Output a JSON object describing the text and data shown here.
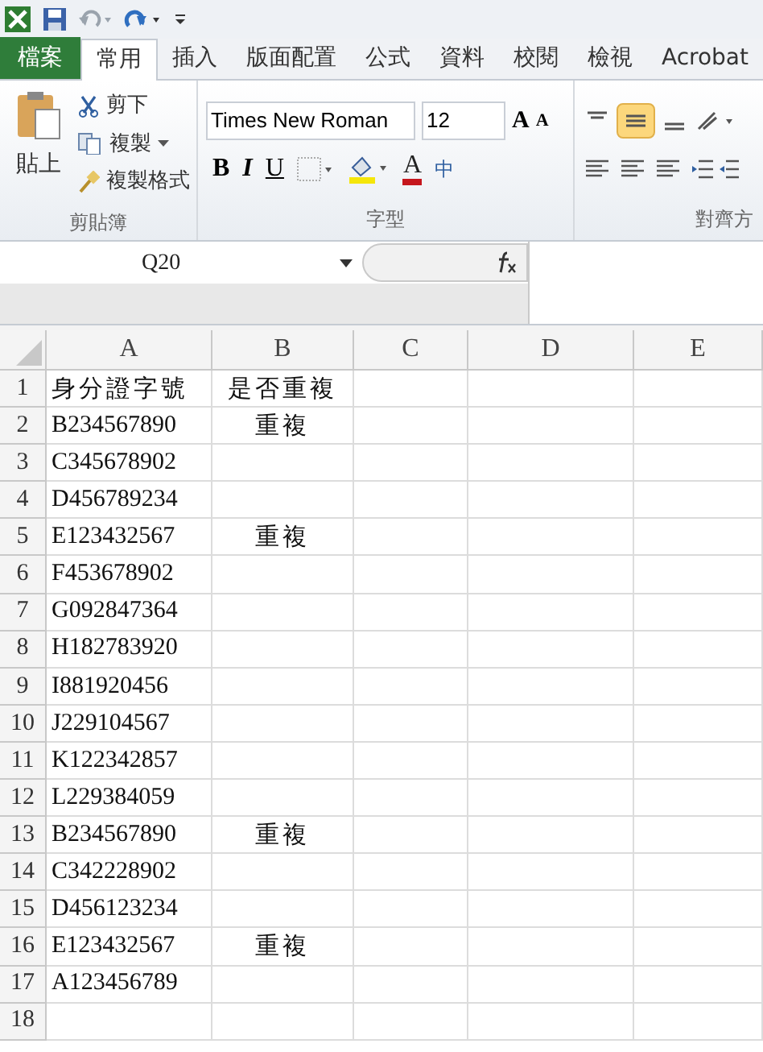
{
  "tabs": [
    {
      "label": "檔案",
      "kind": "file",
      "selected": false
    },
    {
      "label": "常用",
      "kind": "tab",
      "selected": true
    },
    {
      "label": "插入",
      "kind": "tab",
      "selected": false
    },
    {
      "label": "版面配置",
      "kind": "tab",
      "selected": false
    },
    {
      "label": "公式",
      "kind": "tab",
      "selected": false
    },
    {
      "label": "資料",
      "kind": "tab",
      "selected": false
    },
    {
      "label": "校閱",
      "kind": "tab",
      "selected": false
    },
    {
      "label": "檢視",
      "kind": "tab",
      "selected": false
    },
    {
      "label": "Acrobat",
      "kind": "tab",
      "selected": false
    }
  ],
  "clipboard": {
    "paste": "貼上",
    "cut": "剪下",
    "copy": "複製",
    "format_painter": "複製格式",
    "label": "剪貼簿"
  },
  "font": {
    "name": "Times New Roman",
    "size": "12",
    "grow": "A",
    "shrink": "A",
    "bold": "B",
    "italic": "I",
    "underline": "U",
    "font_color": "A",
    "phonetic": "中",
    "label": "字型"
  },
  "alignment": {
    "label": "對齊方",
    "middle_align_selected": true
  },
  "name_box": "Q20",
  "columns": [
    "A",
    "B",
    "C",
    "D",
    "E"
  ],
  "rows": [
    {
      "number": "1",
      "cells": [
        "身分證字號",
        "是否重複"
      ]
    },
    {
      "number": "2",
      "cells": [
        "B234567890",
        "重複"
      ]
    },
    {
      "number": "3",
      "cells": [
        "C345678902",
        ""
      ]
    },
    {
      "number": "4",
      "cells": [
        "D456789234",
        ""
      ]
    },
    {
      "number": "5",
      "cells": [
        "E123432567",
        "重複"
      ]
    },
    {
      "number": "6",
      "cells": [
        "F453678902",
        ""
      ]
    },
    {
      "number": "7",
      "cells": [
        "G092847364",
        ""
      ]
    },
    {
      "number": "8",
      "cells": [
        "H182783920",
        ""
      ]
    },
    {
      "number": "9",
      "cells": [
        "I881920456",
        ""
      ]
    },
    {
      "number": "10",
      "cells": [
        "J229104567",
        ""
      ]
    },
    {
      "number": "11",
      "cells": [
        "K122342857",
        ""
      ]
    },
    {
      "number": "12",
      "cells": [
        "L229384059",
        ""
      ]
    },
    {
      "number": "13",
      "cells": [
        "B234567890",
        "重複"
      ]
    },
    {
      "number": "14",
      "cells": [
        "C342228902",
        ""
      ]
    },
    {
      "number": "15",
      "cells": [
        "D456123234",
        ""
      ]
    },
    {
      "number": "16",
      "cells": [
        "E123432567",
        "重複"
      ]
    },
    {
      "number": "17",
      "cells": [
        "A123456789",
        ""
      ]
    },
    {
      "number": "18",
      "cells": [
        "",
        ""
      ]
    }
  ]
}
